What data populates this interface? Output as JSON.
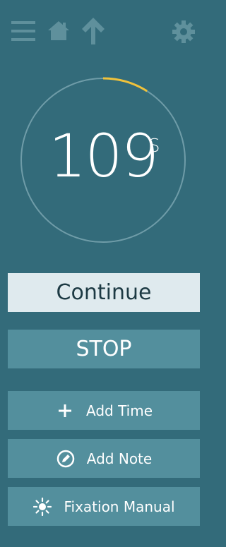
{
  "toolbar": {
    "icons": [
      "menu-icon",
      "home-icon",
      "arrow-up-icon",
      "gear-icon"
    ]
  },
  "timer": {
    "value": "109",
    "unit": "S",
    "progress_fraction": 0.09,
    "ring_color": "#6f9ca8",
    "progress_color": "#f0c23b"
  },
  "buttons": {
    "continue_label": "Continue",
    "stop_label": "STOP",
    "add_time_label": "Add Time",
    "add_note_label": "Add Note",
    "fixation_label": "Fixation Manual"
  },
  "colors": {
    "background": "#336b7a",
    "button": "#538f9d",
    "continue_button": "#dfeaee"
  }
}
